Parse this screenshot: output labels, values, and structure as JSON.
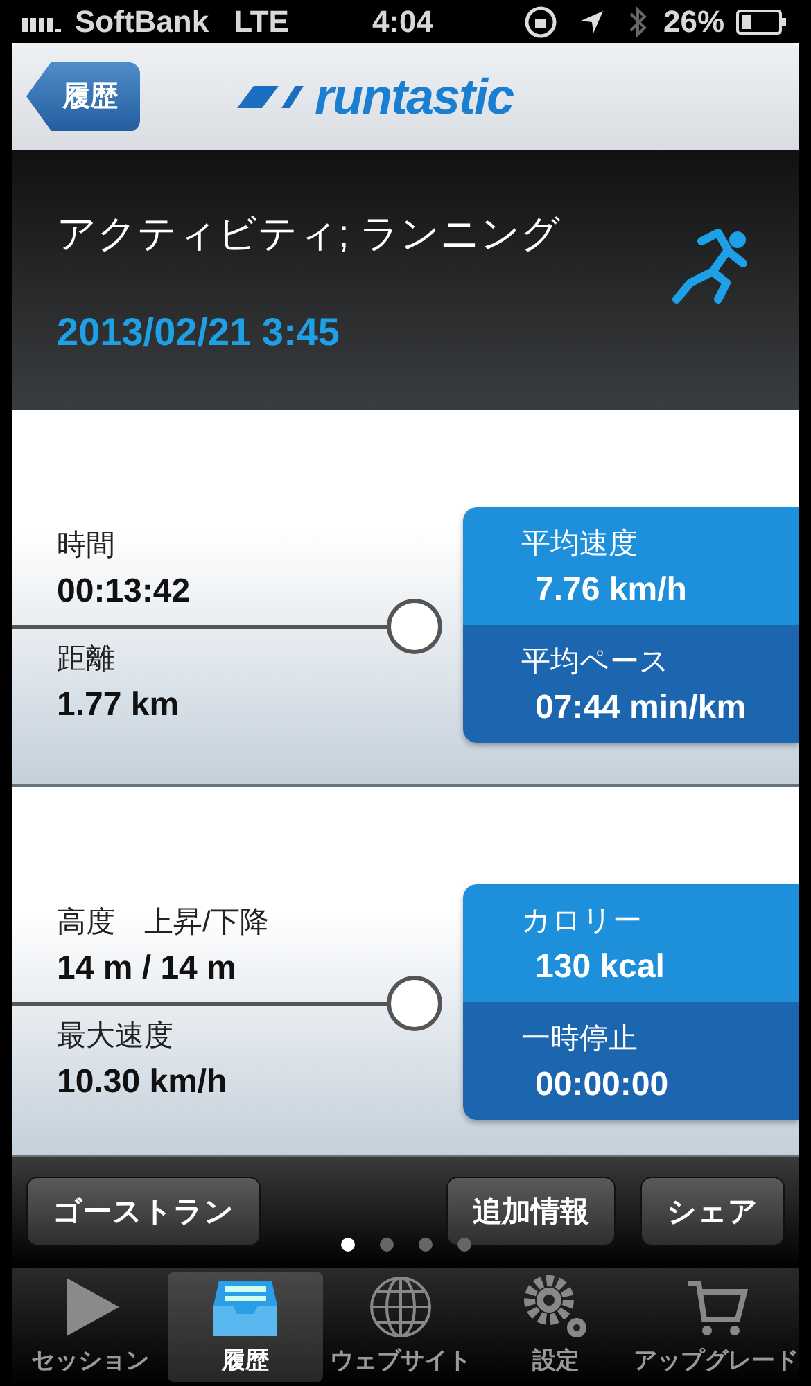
{
  "status_bar": {
    "carrier": "SoftBank",
    "network": "LTE",
    "time": "4:04",
    "battery": "26%"
  },
  "nav": {
    "back": "履歴",
    "logo": "runtastic"
  },
  "activity": {
    "title": "アクティビティ; ランニング",
    "date": "2013/02/21 3:45"
  },
  "stat_groups": [
    {
      "left": [
        {
          "label": "時間",
          "value": "00:13:42"
        },
        {
          "label": "距離",
          "value": "1.77 km"
        }
      ],
      "right": [
        {
          "label": "平均速度",
          "value": "7.76 km/h"
        },
        {
          "label": "平均ペース",
          "value": "07:44 min/km"
        }
      ]
    },
    {
      "left": [
        {
          "label": "高度　上昇/下降",
          "value": "14 m / 14 m"
        },
        {
          "label": "最大速度",
          "value": "10.30 km/h"
        }
      ],
      "right": [
        {
          "label": "カロリー",
          "value": "130 kcal"
        },
        {
          "label": "一時停止",
          "value": "00:00:00"
        }
      ]
    }
  ],
  "actions_left": [
    "ゴーストラン"
  ],
  "actions_right": [
    "追加情報",
    "シェア"
  ],
  "page_dots": [
    {
      "selected": true
    },
    {
      "selected": false
    },
    {
      "selected": false
    },
    {
      "selected": false
    }
  ],
  "tabs": [
    {
      "label": "セッション",
      "kind": "play",
      "selected": false
    },
    {
      "label": "履歴",
      "kind": "tray",
      "selected": true
    },
    {
      "label": "ウェブサイト",
      "kind": "globe",
      "selected": false
    },
    {
      "label": "設定",
      "kind": "gears",
      "selected": false
    },
    {
      "label": "アップグレード",
      "kind": "cart",
      "selected": false
    }
  ]
}
